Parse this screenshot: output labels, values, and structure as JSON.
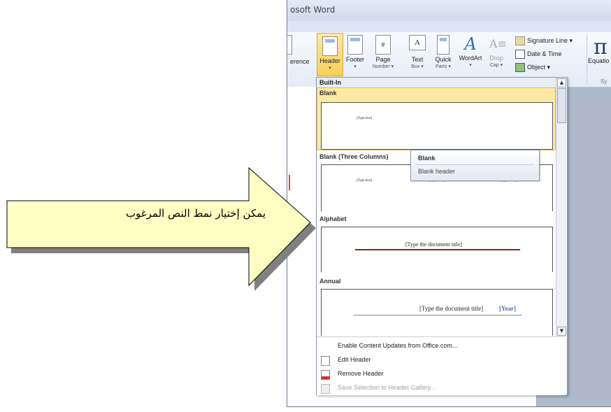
{
  "window": {
    "title": "osoft Word"
  },
  "ribbon": {
    "left_partial": "erence",
    "buttons": [
      {
        "label": "Header",
        "sub": "▾"
      },
      {
        "label": "Footer",
        "sub": "▾"
      },
      {
        "label": "Page",
        "sub": "Number ▾"
      },
      {
        "label": "Text",
        "sub": "Box ▾"
      },
      {
        "label": "Quick",
        "sub": "Parts ▾"
      },
      {
        "label": "WordArt",
        "sub": "▾"
      },
      {
        "label": "Drop",
        "sub": "Cap ▾"
      }
    ],
    "small": [
      {
        "label": "Signature Line ▾",
        "icon": "signature-icon"
      },
      {
        "label": "Date & Time",
        "icon": "calendar-icon"
      },
      {
        "label": "Object ▾",
        "icon": "object-icon"
      }
    ],
    "equation_label": "Equatio",
    "symbol_glyph": "π",
    "group_label": "Sy"
  },
  "gallery": {
    "section": "Built-In",
    "items": [
      {
        "name": "Blank",
        "placeholders": [
          "[Type text]"
        ]
      },
      {
        "name": "Blank (Three Columns)",
        "placeholders": [
          "[Type text]",
          "[Type text]",
          "[Type text]"
        ]
      },
      {
        "name": "Alphabet",
        "placeholders": [
          "[Type the document title]"
        ]
      },
      {
        "name": "Annual",
        "placeholders": [
          "[Type the document title]",
          "[Year]"
        ]
      }
    ]
  },
  "tooltip": {
    "title": "Blank",
    "text": "Blank header"
  },
  "menu": [
    {
      "label": "Enable Content Updates from Office.com...",
      "enabled": true
    },
    {
      "label": "Edit Header",
      "enabled": true
    },
    {
      "label": "Remove Header",
      "enabled": true
    },
    {
      "label": "Save Selection to Header Gallery...",
      "enabled": false
    }
  ],
  "callout": {
    "text": "يمكن إختيار نمط النص المرغوب",
    "color": "#ffffc4"
  }
}
